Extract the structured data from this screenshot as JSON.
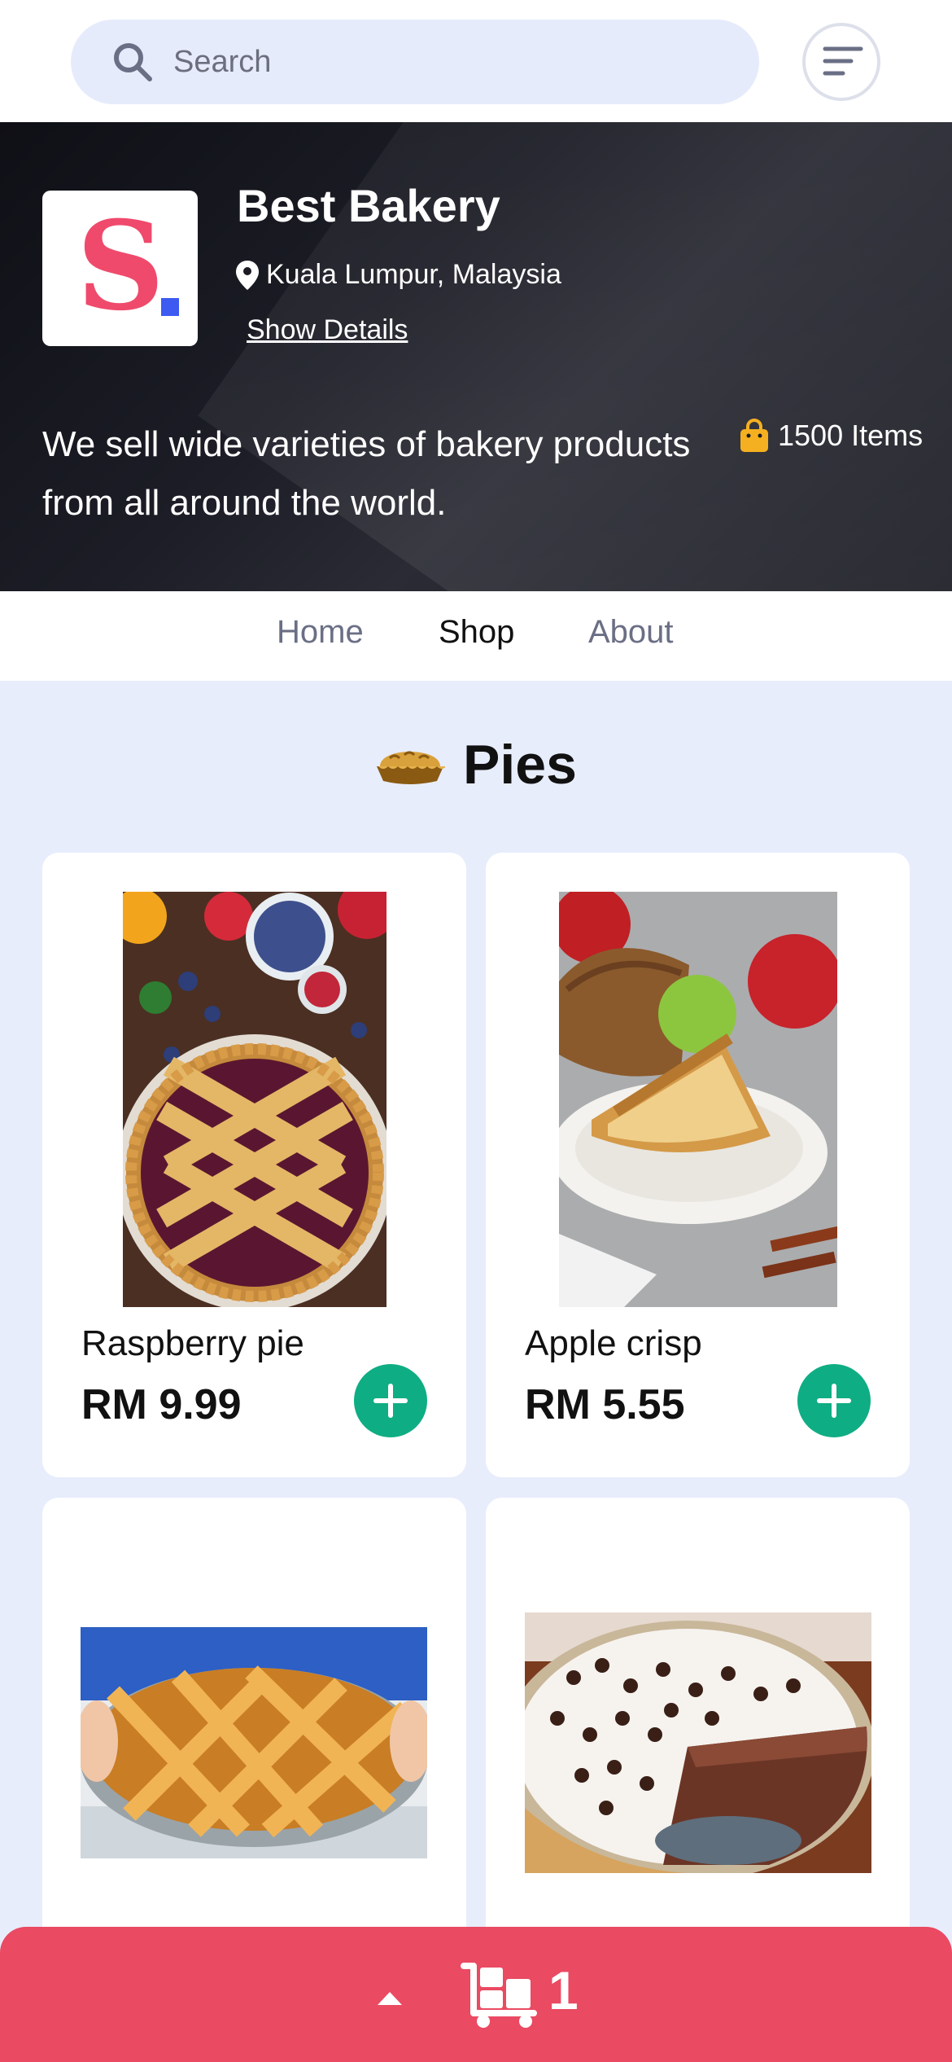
{
  "search": {
    "placeholder": "Search"
  },
  "shop": {
    "name": "Best Bakery",
    "location": "Kuala Lumpur, Malaysia",
    "show_details": "Show Details",
    "tagline": "We sell wide varieties of bakery products from all around the world.",
    "items_count": "1500 Items",
    "logo_letter": "S"
  },
  "nav": {
    "tabs": [
      {
        "label": "Home"
      },
      {
        "label": "Shop"
      },
      {
        "label": "About"
      }
    ],
    "active": "Shop"
  },
  "category": {
    "title": "Pies",
    "icon": "pie-icon"
  },
  "products": [
    {
      "name": "Raspberry pie",
      "price": "RM 9.99"
    },
    {
      "name": "Apple crisp",
      "price": "RM 5.55"
    }
  ],
  "cart": {
    "count": "1"
  },
  "colors": {
    "accent_green": "#0fad83",
    "cart_red": "#ea4a62",
    "background": "#e8edfc",
    "search_bg": "#e6ebfc",
    "logo_pink": "#ef4a6c"
  }
}
